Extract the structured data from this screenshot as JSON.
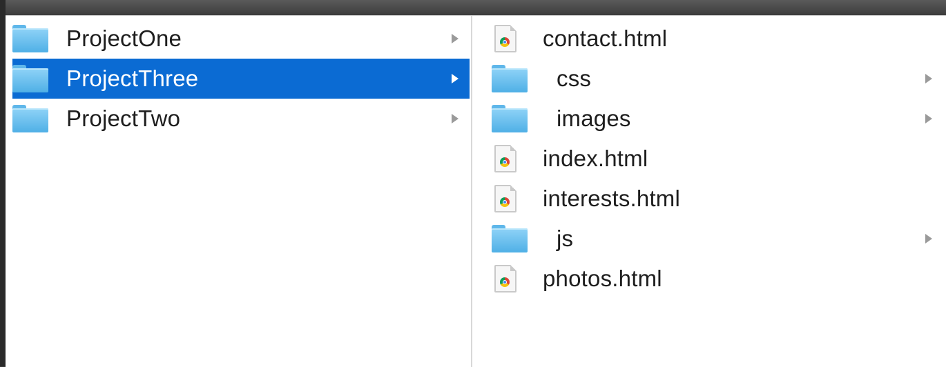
{
  "left_column": {
    "items": [
      {
        "label": "ProjectOne",
        "kind": "folder",
        "selected": false,
        "icon": "folder-icon"
      },
      {
        "label": "ProjectThree",
        "kind": "folder",
        "selected": true,
        "icon": "folder-icon"
      },
      {
        "label": "ProjectTwo",
        "kind": "folder",
        "selected": false,
        "icon": "folder-icon"
      }
    ]
  },
  "right_column": {
    "items": [
      {
        "label": "contact.html",
        "kind": "file",
        "icon": "chrome-html-file-icon"
      },
      {
        "label": "css",
        "kind": "folder",
        "icon": "folder-icon"
      },
      {
        "label": "images",
        "kind": "folder",
        "icon": "folder-icon"
      },
      {
        "label": "index.html",
        "kind": "file",
        "icon": "chrome-html-file-icon"
      },
      {
        "label": "interests.html",
        "kind": "file",
        "icon": "chrome-html-file-icon"
      },
      {
        "label": "js",
        "kind": "folder",
        "icon": "folder-icon"
      },
      {
        "label": "photos.html",
        "kind": "file",
        "icon": "chrome-html-file-icon"
      }
    ]
  },
  "colors": {
    "selection": "#0b6bd3",
    "folder": "#5fb7ea",
    "text": "#1e1e1e",
    "chevron": "#9a9a9a"
  }
}
